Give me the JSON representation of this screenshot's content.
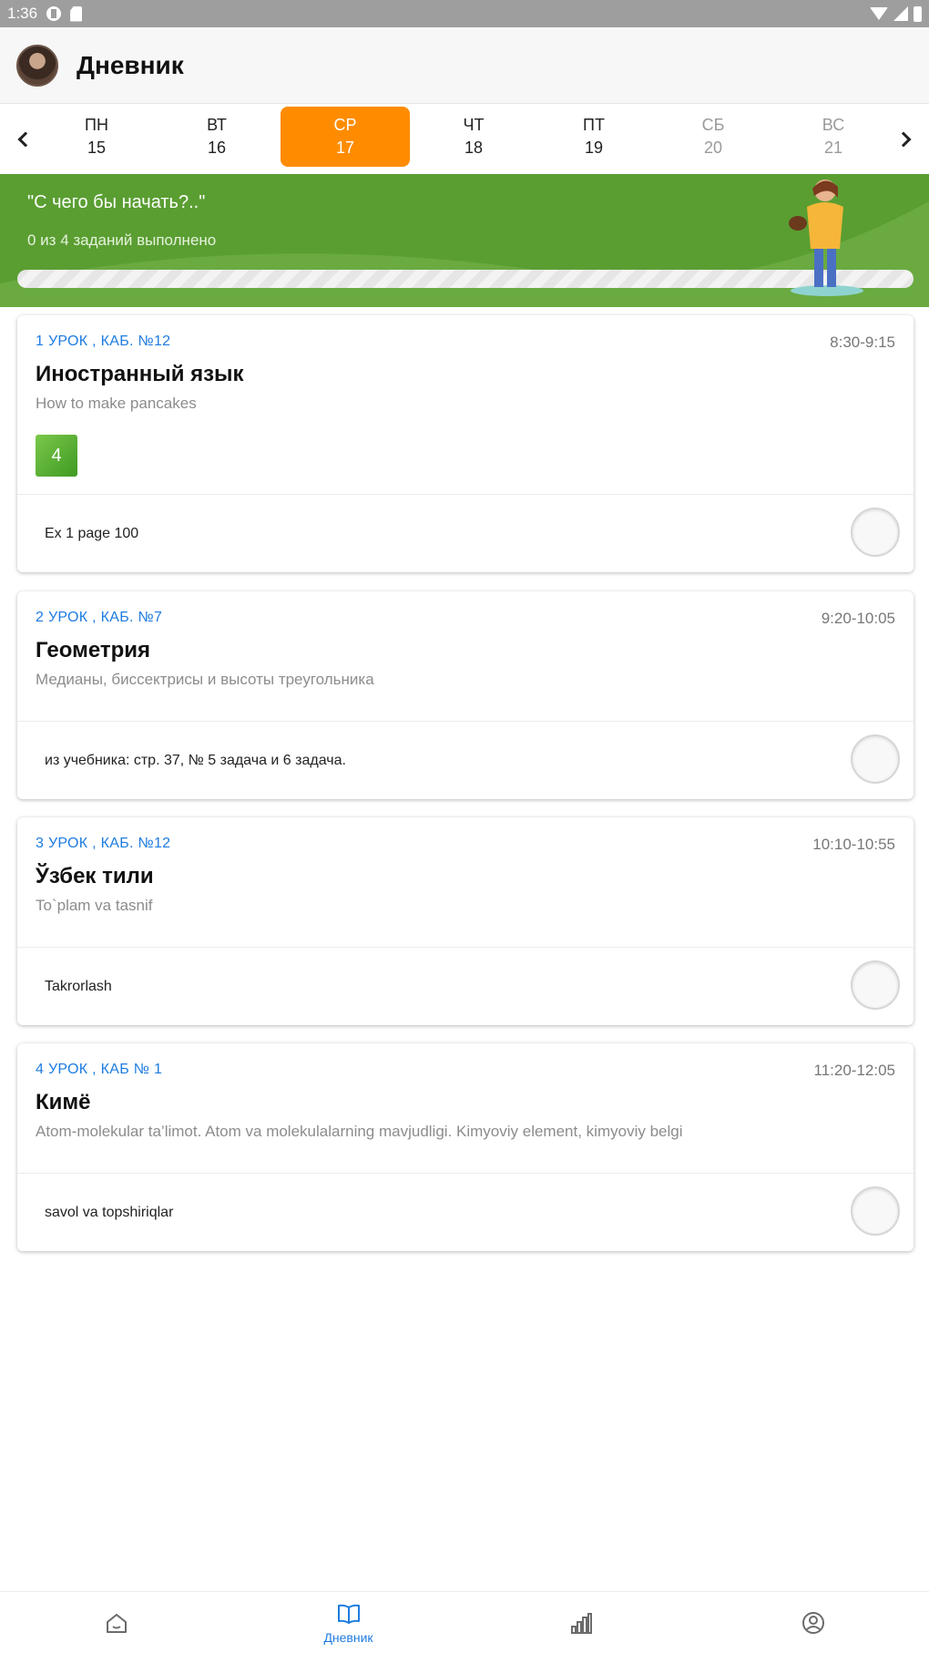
{
  "status_bar": {
    "time": "1:36"
  },
  "app_bar": {
    "title": "Дневник"
  },
  "week": {
    "days": [
      {
        "name": "ПН",
        "date": "15"
      },
      {
        "name": "ВТ",
        "date": "16"
      },
      {
        "name": "СР",
        "date": "17"
      },
      {
        "name": "ЧТ",
        "date": "18"
      },
      {
        "name": "ПТ",
        "date": "19"
      },
      {
        "name": "СБ",
        "date": "20"
      },
      {
        "name": "ВС",
        "date": "21"
      }
    ]
  },
  "banner": {
    "title": "\"С чего бы начать?..\"",
    "subtitle": "0 из  4 заданий выполнено",
    "progress": 0
  },
  "lessons": [
    {
      "number": "1 УРОК , КАБ. №12",
      "time": "8:30-9:15",
      "subject": "Иностранный язык",
      "topic": "How to make pancakes",
      "grade": "4",
      "homework": "Ex 1 page 100"
    },
    {
      "number": "2 УРОК , КАБ. №7",
      "time": "9:20-10:05",
      "subject": "Геометрия",
      "topic": "Медианы, биссектрисы и высоты треугольника",
      "homework": "из учебника: стр. 37,  № 5 задача и 6 задача."
    },
    {
      "number": "3 УРОК , КАБ. №12",
      "time": "10:10-10:55",
      "subject": "Ўзбек тили",
      "topic": "To`plam  va tasnif",
      "homework": "Takrorlash"
    },
    {
      "number": "4 УРОК , КАБ № 1",
      "time": "11:20-12:05",
      "subject": "Кимё",
      "topic": "Atom-molekular ta’limot. Atom va molekulalarning mavjudligi. Kimyoviy element, kimyoviy belgi",
      "homework": "savol va topshiriqlar"
    }
  ],
  "bottom_nav": {
    "diary_label": "Дневник"
  },
  "colors": {
    "accent": "#ff8c00",
    "banner": "#5a9e32",
    "link": "#1e7ce0"
  }
}
